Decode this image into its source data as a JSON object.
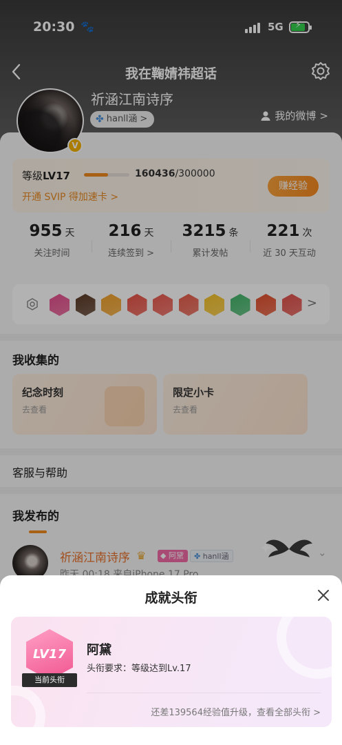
{
  "status_bar": {
    "time": "20:30",
    "network": "5G",
    "time_icon": "paw-icon",
    "signal_icon": "signal-bars-icon",
    "battery_icon": "battery-charging-icon"
  },
  "nav": {
    "title": "我在鞠婧祎超话",
    "back_icon": "chevron-left-icon",
    "settings_icon": "gear-icon"
  },
  "profile": {
    "name": "祈涵江南诗序",
    "fan_tag": "hanll涵",
    "fan_tag_chevron": ">",
    "my_weibo": "我的微博",
    "my_weibo_chevron": ">",
    "verified_mark": "V"
  },
  "level": {
    "label": "等级",
    "level": "LV17",
    "exp_current": "160436",
    "exp_total": "/300000",
    "progress": 0.53,
    "svip_text": "开通 SVIP 得加速卡 >",
    "earn_button": "赚经验"
  },
  "stats": [
    {
      "value": "955",
      "unit": "天",
      "label": "关注时间"
    },
    {
      "value": "216",
      "unit": "天",
      "label": "连续签到 >"
    },
    {
      "value": "3215",
      "unit": "条",
      "label": "累计发帖"
    },
    {
      "value": "221",
      "unit": "次",
      "label": "近 30 天互动"
    }
  ],
  "medals": {
    "arrow": ">",
    "colors": [
      "#e44f8c",
      "#5a3a26",
      "#f0a12a",
      "#e75346",
      "#e95a50",
      "#e65c4a",
      "#f4c22a",
      "#44b56a",
      "#e2502e",
      "#e0504a"
    ]
  },
  "collection": {
    "title": "我收集的",
    "cards": [
      {
        "title": "纪念时刻",
        "sub": "去查看"
      },
      {
        "title": "限定小卡",
        "sub": "去查看"
      }
    ]
  },
  "help": {
    "label": "客服与帮助"
  },
  "published": {
    "title": "我发布的"
  },
  "post": {
    "user": "祈涵江南诗序",
    "vip_tag": "阿黛",
    "fan_tag": "hanll涵",
    "meta": "昨天 00:18  来自iPhone 17 Pro",
    "chevron": "⌄"
  },
  "sheet": {
    "title": "成就头衔",
    "badge_level": "LV17",
    "ribbon": "当前头衔",
    "badge_name": "阿黛",
    "requirement": "头衔要求：等级达到Lv.17",
    "upgrade_text": "还差139564经验值升级，查看全部头衔 >"
  }
}
